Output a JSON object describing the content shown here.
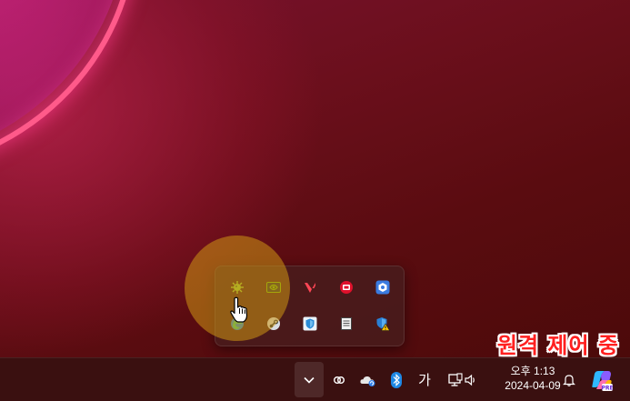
{
  "tray_overflow": {
    "icons": [
      {
        "name": "virus-icon"
      },
      {
        "name": "nvidia-icon"
      },
      {
        "name": "valorant-icon"
      },
      {
        "name": "epic-icon"
      },
      {
        "name": "shield-app-icon"
      },
      {
        "name": "edge-icon"
      },
      {
        "name": "steam-icon"
      },
      {
        "name": "defender-icon"
      },
      {
        "name": "notepad-icon"
      },
      {
        "name": "security-warning-icon"
      }
    ]
  },
  "overlay": {
    "remote_control_label": "원격 제어 중"
  },
  "taskbar": {
    "ime_label": "가",
    "clock_time": "오후 1:13",
    "clock_date": "2024-04-09"
  },
  "colors": {
    "accent_remote": "#ff2020",
    "bluetooth": "#1e88e5",
    "highlight": "#cd9614"
  }
}
